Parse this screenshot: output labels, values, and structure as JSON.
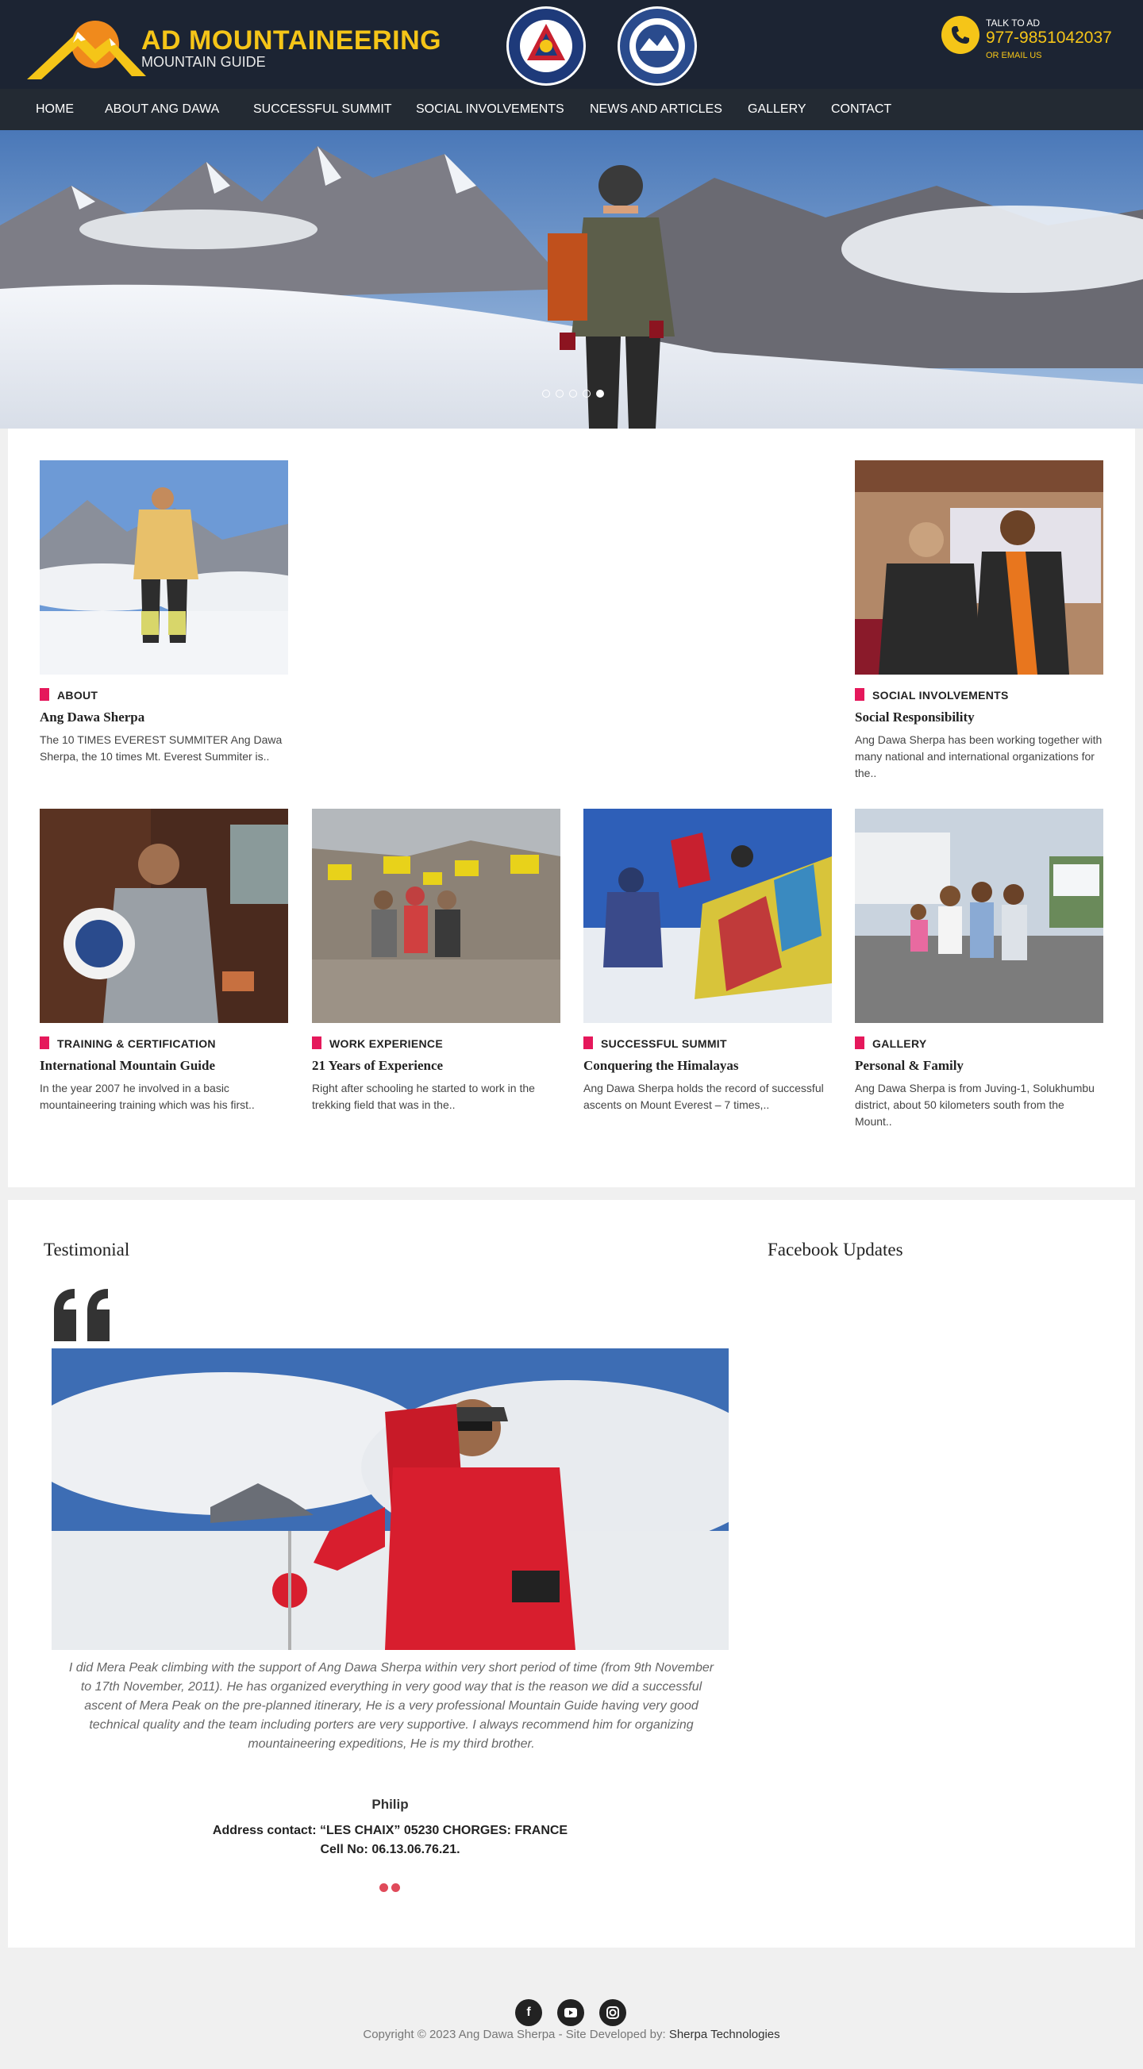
{
  "header": {
    "logo_title": "AD MOUNTAINEERING",
    "logo_subtitle": "MOUNTAIN GUIDE",
    "talk_label": "TALK TO AD",
    "phone": "977-9851042037",
    "email_label": "OR EMAIL US",
    "badges": [
      "NNMGA",
      "IVBV"
    ],
    "colors": {
      "background": "#1c2433",
      "accent": "#f5c518"
    }
  },
  "nav": {
    "items": [
      "HOME",
      "ABOUT ANG DAWA",
      "SUCCESSFUL SUMMIT",
      "SOCIAL INVOLVEMENTS",
      "NEWS AND ARTICLES",
      "GALLERY",
      "CONTACT"
    ]
  },
  "hero": {
    "slide_count": 5,
    "active_slide": 5
  },
  "cards": [
    {
      "category": "ABOUT",
      "title": "Ang Dawa Sherpa",
      "desc": "The 10 TIMES EVEREST SUMMITER Ang Dawa Sherpa, the 10 times Mt. Everest Summiter is.."
    },
    {
      "category": "SOCIAL INVOLVEMENTS",
      "title": "Social Responsibility",
      "desc": "Ang Dawa Sherpa has been working together with many national and international organizations for the.."
    },
    {
      "category": "TRAINING & CERTIFICATION",
      "title": "International Mountain Guide",
      "desc": "In the year 2007 he involved in a basic mountaineering training which was his first.."
    },
    {
      "category": "WORK EXPERIENCE",
      "title": "21 Years of Experience",
      "desc": "Right after schooling he started to work in the trekking field that was in the.."
    },
    {
      "category": "SUCCESSFUL SUMMIT",
      "title": "Conquering the Himalayas",
      "desc": "Ang Dawa Sherpa holds the record of successful ascents on Mount Everest – 7 times,.."
    },
    {
      "category": "GALLERY",
      "title": "Personal & Family",
      "desc": "Ang Dawa Sherpa is from Juving-1, Solukhumbu district, about 50 kilometers south from the Mount.."
    }
  ],
  "testimonial": {
    "heading": "Testimonial",
    "quote": "I did Mera Peak climbing with the support of Ang Dawa Sherpa within very short period of time (from 9th November to 17th November, 2011). He has organized everything in very good way that is the reason we did a successful ascent of Mera Peak on the pre-planned itinerary, He is a very professional Mountain Guide having very good technical quality and the team including porters are very supportive. I always recommend him for organizing mountaineering expeditions, He is my third brother.",
    "name": "Philip",
    "address": "Address contact: “LES CHAIX” 05230 CHORGES: FRANCE",
    "cell": "Cell No: 06.13.06.76.21."
  },
  "facebook": {
    "heading": "Facebook Updates"
  },
  "footer": {
    "social": [
      "facebook-icon",
      "youtube-icon",
      "instagram-icon"
    ],
    "copyright": "Copyright © 2023 Ang Dawa Sherpa   -   Site Developed by: ",
    "developer": "Sherpa Technologies"
  }
}
